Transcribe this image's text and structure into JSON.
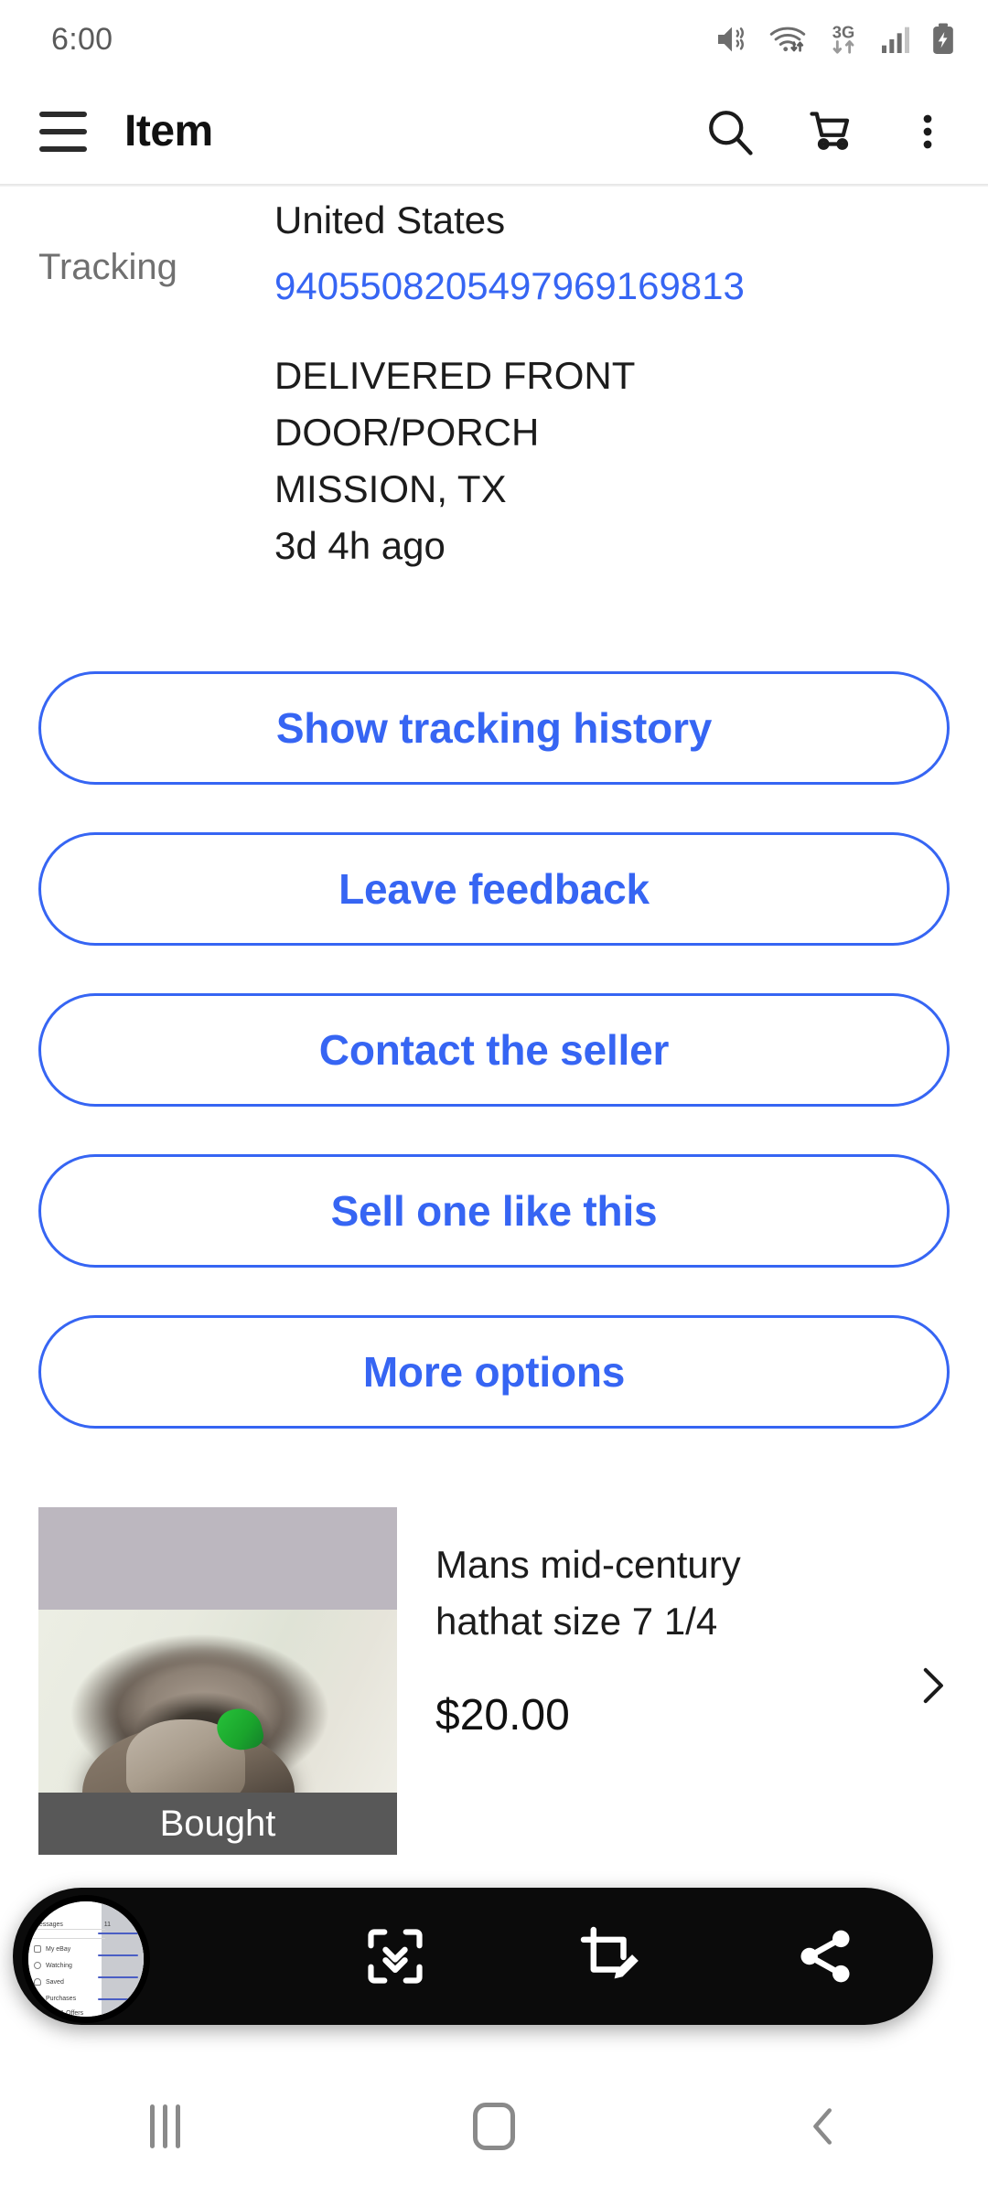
{
  "status_bar": {
    "time": "6:00",
    "icons": [
      "mute-vibrate-icon",
      "wifi-data-icon",
      "3g-data-icon",
      "signal-bars-icon",
      "battery-charging-icon"
    ],
    "network_label": "3G"
  },
  "app_bar": {
    "title": "Item",
    "menu_icon": "hamburger-menu-icon",
    "actions": [
      "search-icon",
      "cart-icon",
      "overflow-menu-icon"
    ]
  },
  "tracking": {
    "country": "United States",
    "label": "Tracking",
    "number": "940550820549796916 98 13",
    "number_display": "9405508205497969169813",
    "status_lines": [
      "DELIVERED FRONT",
      "DOOR/PORCH",
      "MISSION, TX",
      "3d 4h ago"
    ]
  },
  "actions": [
    {
      "label": "Show tracking history",
      "name": "show-tracking-history-button"
    },
    {
      "label": "Leave feedback",
      "name": "leave-feedback-button"
    },
    {
      "label": "Contact the seller",
      "name": "contact-seller-button"
    },
    {
      "label": "Sell one like this",
      "name": "sell-one-like-this-button"
    },
    {
      "label": "More options",
      "name": "more-options-button"
    }
  ],
  "product": {
    "title": "Mans mid-century hathat size 7 1/4",
    "price": "$20.00",
    "badge": "Bought",
    "chevron_icon": "chevron-right-icon",
    "image_alt": "tan fedora hat with green ribbon"
  },
  "screenshot_toolbar": {
    "tools": [
      {
        "label": "Scroll capture",
        "name": "scroll-capture-icon"
      },
      {
        "label": "Crop and edit",
        "name": "crop-edit-icon"
      },
      {
        "label": "Share",
        "name": "share-icon"
      }
    ],
    "preview_items": [
      "Messages",
      "My eBay",
      "Watching",
      "Saved",
      "Purchases",
      "Bids & Offers"
    ],
    "preview_badge": "11"
  },
  "nav_bar": {
    "items": [
      {
        "label": "Recents",
        "name": "nav-recents-button"
      },
      {
        "label": "Home",
        "name": "nav-home-button"
      },
      {
        "label": "Back",
        "name": "nav-back-button"
      }
    ]
  },
  "colors": {
    "link_blue": "#3665f3",
    "text_dark": "#1c1c1c",
    "text_muted": "#707070",
    "badge_grey": "#585858",
    "toolbar_black": "#0b0b0b"
  }
}
